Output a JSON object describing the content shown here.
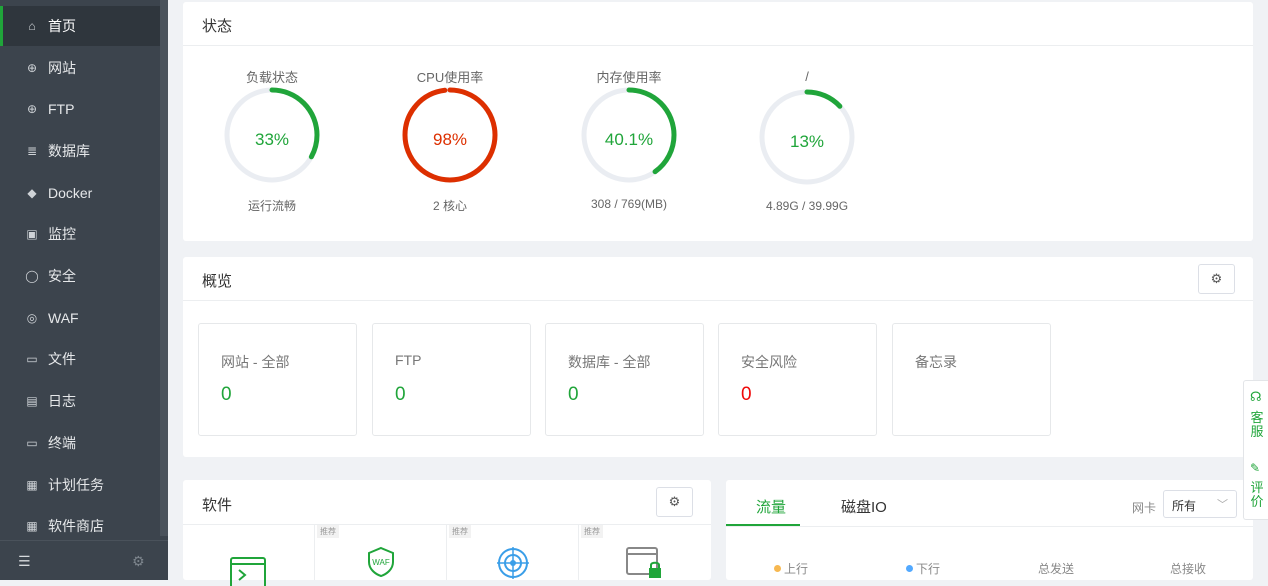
{
  "sidebar": {
    "items": [
      {
        "label": "首页",
        "icon": "home-icon",
        "glyph": "⌂"
      },
      {
        "label": "网站",
        "icon": "globe-icon",
        "glyph": "⊕"
      },
      {
        "label": "FTP",
        "icon": "ftp-icon",
        "glyph": "⊕"
      },
      {
        "label": "数据库",
        "icon": "database-icon",
        "glyph": "≣"
      },
      {
        "label": "Docker",
        "icon": "docker-icon",
        "glyph": "◆"
      },
      {
        "label": "监控",
        "icon": "monitor-icon",
        "glyph": "▣"
      },
      {
        "label": "安全",
        "icon": "shield-icon",
        "glyph": "◯"
      },
      {
        "label": "WAF",
        "icon": "waf-shield-icon",
        "glyph": "◎"
      },
      {
        "label": "文件",
        "icon": "folder-icon",
        "glyph": "▭"
      },
      {
        "label": "日志",
        "icon": "log-icon",
        "glyph": "▤"
      },
      {
        "label": "终端",
        "icon": "terminal-icon",
        "glyph": "▭"
      },
      {
        "label": "计划任务",
        "icon": "calendar-icon",
        "glyph": "▦"
      },
      {
        "label": "软件商店",
        "icon": "store-icon",
        "glyph": "▦"
      }
    ],
    "bottom_left_glyph": "☰",
    "bottom_right_glyph": "⚙"
  },
  "status": {
    "title": "状态",
    "gauges": [
      {
        "label": "负载状态",
        "value": "33%",
        "percent": 33,
        "sub": "运行流畅",
        "color": "#20a53a"
      },
      {
        "label": "CPU使用率",
        "value": "98%",
        "percent": 98,
        "sub": "2 核心",
        "color": "#dd2f00"
      },
      {
        "label": "内存使用率",
        "value": "40.1%",
        "percent": 40.1,
        "sub": "308 / 769(MB)",
        "color": "#20a53a"
      },
      {
        "label": "/",
        "value": "13%",
        "percent": 13,
        "sub": "4.89G / 39.99G",
        "color": "#20a53a"
      }
    ]
  },
  "overview": {
    "title": "概览",
    "cards": [
      {
        "label": "网站 - 全部",
        "value": "0",
        "danger": false
      },
      {
        "label": "FTP",
        "value": "0",
        "danger": false
      },
      {
        "label": "数据库 - 全部",
        "value": "0",
        "danger": false
      },
      {
        "label": "安全风险",
        "value": "0",
        "danger": true
      },
      {
        "label": "备忘录",
        "value": "",
        "danger": false
      }
    ]
  },
  "software": {
    "title": "软件",
    "tag": "推荐"
  },
  "traffic": {
    "tabs": [
      "流量",
      "磁盘IO"
    ],
    "nic_label": "网卡",
    "nic_value": "所有",
    "legend": [
      {
        "label": "上行",
        "color": "#f7b851"
      },
      {
        "label": "下行",
        "color": "#52a9ff"
      },
      {
        "label": "总发送"
      },
      {
        "label": "总接收"
      }
    ]
  },
  "float": {
    "service": "客服",
    "review": "评价"
  },
  "colors": {
    "accent": "#20a53a",
    "danger": "#dd2f00",
    "sidebar": "#3c444d"
  }
}
